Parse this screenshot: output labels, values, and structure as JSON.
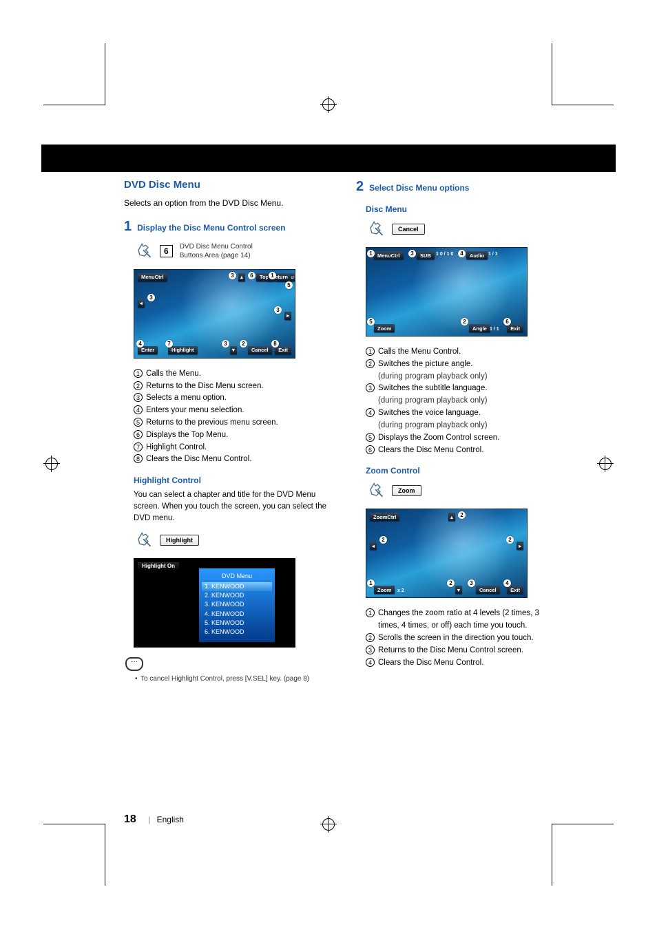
{
  "header": {},
  "left": {
    "section_title": "DVD Disc Menu",
    "intro": "Selects an option from the DVD Disc Menu.",
    "step1": {
      "num": "1",
      "title": "Display the Disc Menu Control screen",
      "box_num": "6",
      "box_caption": "DVD Disc Menu Control Buttons Area (page 14)"
    },
    "ss1": {
      "menuctrl": "MenuCtrl",
      "top": "Top",
      "menu": "Menu",
      "return": "Return",
      "enter": "Enter",
      "highlight": "Highlight",
      "cancel": "Cancel",
      "exit": "Exit"
    },
    "list1": [
      "Calls the Menu.",
      "Returns to the Disc Menu screen.",
      "Selects a menu option.",
      "Enters your menu selection.",
      "Returns to the previous menu screen.",
      "Displays the Top Menu.",
      "Highlight Control.",
      "Clears the Disc Menu Control."
    ],
    "highlight_title": "Highlight Control",
    "highlight_para": "You can select a chapter and title for the DVD Menu screen. When you touch the screen, you can select the DVD menu.",
    "highlight_btn": "Highlight",
    "dvdmenu": {
      "highlight_on": "Highlight On",
      "title": "DVD Menu",
      "items": [
        "1. KENWOOD",
        "2. KENWOOD",
        "3. KENWOOD",
        "4. KENWOOD",
        "5. KENWOOD",
        "6. KENWOOD"
      ]
    },
    "note": "To cancel Highlight Control, press [V.SEL] key. (page 8)"
  },
  "right": {
    "step2": {
      "num": "2",
      "title": "Select Disc Menu options"
    },
    "discmenu_title": "Disc Menu",
    "cancel_btn": "Cancel",
    "ss2": {
      "menuctrl": "MenuCtrl",
      "sub": "SUB",
      "sub_val": "1 0 / 1 0",
      "audio": "Audio",
      "audio_val": "1 / 1",
      "zoom": "Zoom",
      "angle": "Angle",
      "angle_val": "1 / 1",
      "exit": "Exit"
    },
    "list2": [
      {
        "t": "Calls the Menu Control."
      },
      {
        "t": "Switches the picture angle.",
        "s": "(during program playback only)"
      },
      {
        "t": "Switches the subtitle language.",
        "s": "(during program playback only)"
      },
      {
        "t": "Switches the voice language.",
        "s": "(during program playback only)"
      },
      {
        "t": "Displays the Zoom Control screen."
      },
      {
        "t": "Clears the Disc Menu Control."
      }
    ],
    "zoom_title": "Zoom Control",
    "zoom_btn": "Zoom",
    "ss3": {
      "zoomctrl": "ZoomCtrl",
      "zoom": "Zoom",
      "zoom_val": "x 2",
      "cancel": "Cancel",
      "exit": "Exit"
    },
    "list3": [
      "Changes the zoom ratio at 4 levels (2 times, 3 times, 4 times, or off) each time you touch.",
      "Scrolls the screen in the direction you touch.",
      "Returns to the Disc Menu Control screen.",
      "Clears the Disc Menu Control."
    ]
  },
  "footer": {
    "page": "18",
    "lang": "English"
  }
}
